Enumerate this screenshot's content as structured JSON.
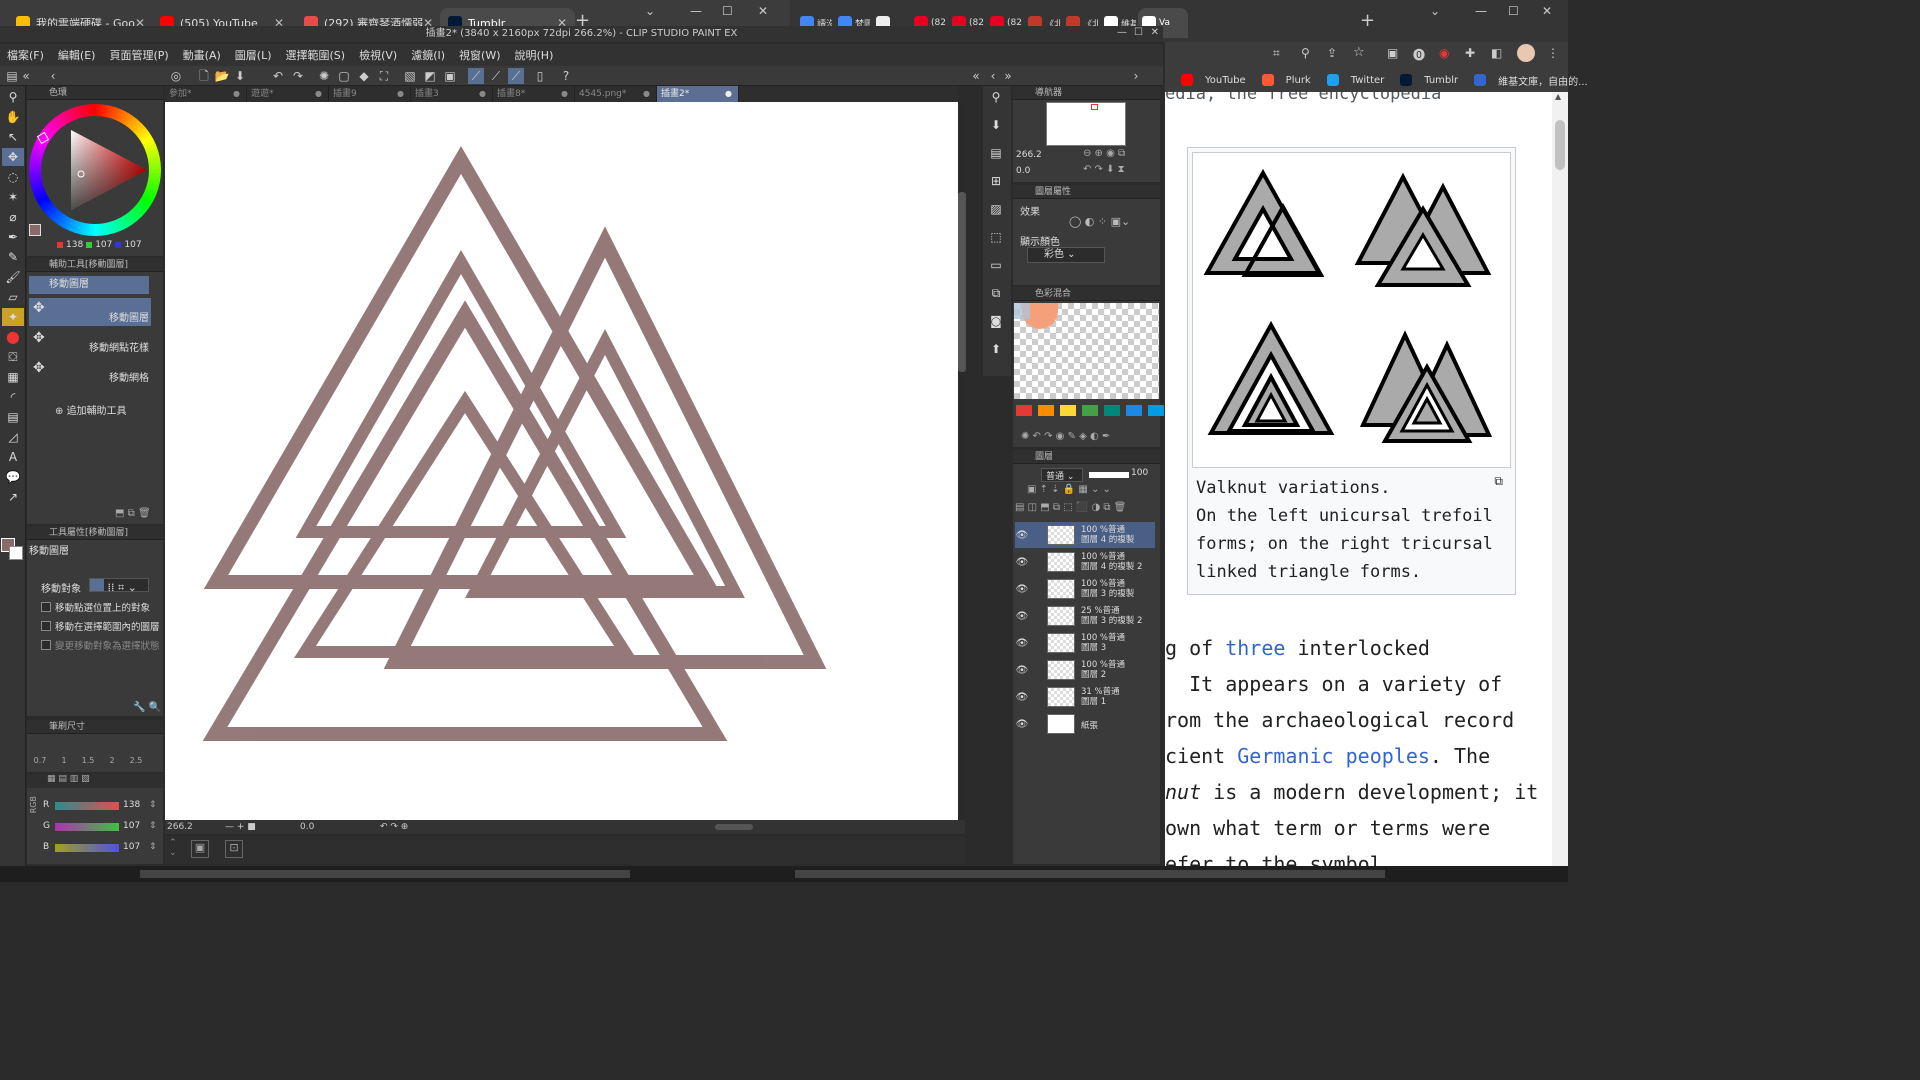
{
  "left_tabs": [
    {
      "label": "我的雲端硬碟 - Goo",
      "color": "#fbbc04"
    },
    {
      "label": "(505) YouTube",
      "color": "#ff0000"
    },
    {
      "label": "(292) 審齊琴酒懦弱",
      "color": "#e84b4b"
    },
    {
      "label": "Tumblr",
      "color": "#001935",
      "active": true
    }
  ],
  "right_tabs": [
    {
      "label": "讀沒有",
      "color": "#4285f4"
    },
    {
      "label": "梵圖",
      "color": "#4285f4"
    },
    {
      "label": "",
      "color": "#eeeeee"
    },
    {
      "label": "(82) P",
      "color": "#e60023"
    },
    {
      "label": "(82) P",
      "color": "#e60023"
    },
    {
      "label": "(82) P",
      "color": "#e60023"
    },
    {
      "label": "《北京",
      "color": "#c0392b"
    },
    {
      "label": "《北京",
      "color": "#c0392b"
    },
    {
      "label": "維基",
      "color": "#ffffff"
    },
    {
      "label": "Va",
      "color": "#ffffff",
      "active": true
    }
  ],
  "csp": {
    "title": "插畫2* (3840 x 2160px 72dpi 266.2%) - CLIP STUDIO PAINT EX",
    "menu": [
      "檔案(F)",
      "編輯(E)",
      "頁面管理(P)",
      "動畫(A)",
      "圖層(L)",
      "選擇範圍(S)",
      "檢視(V)",
      "濾鏡(I)",
      "視窗(W)",
      "說明(H)"
    ],
    "doc_tabs": [
      {
        "label": "參加*"
      },
      {
        "label": "遊遊*"
      },
      {
        "label": "插畫9"
      },
      {
        "label": "插畫3"
      },
      {
        "label": "插畫8*"
      },
      {
        "label": "4545.png*"
      },
      {
        "label": "插畫2*",
        "active": true
      }
    ],
    "color_panel": {
      "title": "色環",
      "r": "138",
      "g": "107",
      "b": "107"
    },
    "subtool_panel": {
      "title": "輔助工具[移動圖層]",
      "group": "移動圖層",
      "items": [
        "移動圖層",
        "移動網點花樣",
        "移動網格"
      ],
      "add": "追加輔助工具"
    },
    "toolprop": {
      "title": "工具屬性[移動圖層]",
      "name": "移動圖層",
      "target_label": "移動對象",
      "opts": [
        "移動點選位置上的對象",
        "移動在選擇範圍內的圖層",
        "變更移動對象為選擇狀態"
      ]
    },
    "brush_size": {
      "title": "筆刷尺寸",
      "sizes": [
        "0.7",
        "1",
        "1.5",
        "2",
        "2.5"
      ]
    },
    "rgb": {
      "mode": "RGB",
      "r": "138",
      "g": "107",
      "b": "107"
    },
    "status": {
      "zoom": "266.2",
      "angle": "0.0"
    },
    "navigator": {
      "title": "導航器",
      "zoom": "266.2",
      "angle": "0.0"
    },
    "layer_prop": {
      "title": "圖層屬性",
      "effect": "效果",
      "display": "顯示顏色",
      "display_value": "彩色"
    },
    "colormix": {
      "title": "色彩混合",
      "swatches": [
        "#e53935",
        "#fb8c00",
        "#fdd835",
        "#43a047",
        "#00897b",
        "#1e88e5",
        "#039be5"
      ]
    },
    "layer_panel": {
      "title": "圖層",
      "blend": "普通",
      "opacity": "100"
    },
    "layers": [
      {
        "line1": "100 %普通",
        "line2": "圖層 4 的複製",
        "sel": true
      },
      {
        "line1": "100 %普通",
        "line2": "圖層 4 的複製 2"
      },
      {
        "line1": "100 %普通",
        "line2": "圖層 3 的複製"
      },
      {
        "line1": "25 %普通",
        "line2": "圖層 3 的複製 2"
      },
      {
        "line1": "100 %普通",
        "line2": "圖層 3"
      },
      {
        "line1": "100 %普通",
        "line2": "圖層 2"
      },
      {
        "line1": "31 %普通",
        "line2": "圖層 1"
      },
      {
        "line1": "",
        "line2": "紙張",
        "paper": true
      }
    ],
    "stroke_color": "#8a6b6b"
  },
  "chrome": {
    "bookmarks": [
      "YouTube",
      "Plurk",
      "Twitter",
      "Tumblr",
      "維基文庫，自由的..."
    ],
    "top_text": "edia, the free encyclopedia",
    "caption": [
      "Valknut variations.",
      "On the left unicursal trefoil",
      "forms; on the right tricursal",
      "linked triangle forms."
    ],
    "body": [
      {
        "segments": [
          {
            "t": "g of "
          },
          {
            "t": "three",
            "link": true
          },
          {
            "t": " interlocked"
          }
        ]
      },
      {
        "segments": [
          {
            "t": "  It appears on a variety of"
          }
        ]
      },
      {
        "segments": [
          {
            "t": "rom the archaeological record"
          }
        ]
      },
      {
        "segments": [
          {
            "t": "cient "
          },
          {
            "t": "Germanic peoples",
            "link": true
          },
          {
            "t": ". The"
          }
        ]
      },
      {
        "segments": [
          {
            "t": "nut",
            "italic": true
          },
          {
            "t": " is a modern development; it"
          }
        ]
      },
      {
        "segments": [
          {
            "t": "own what term or terms were"
          }
        ]
      },
      {
        "segments": [
          {
            "t": "efer to the symbol"
          }
        ]
      }
    ]
  }
}
